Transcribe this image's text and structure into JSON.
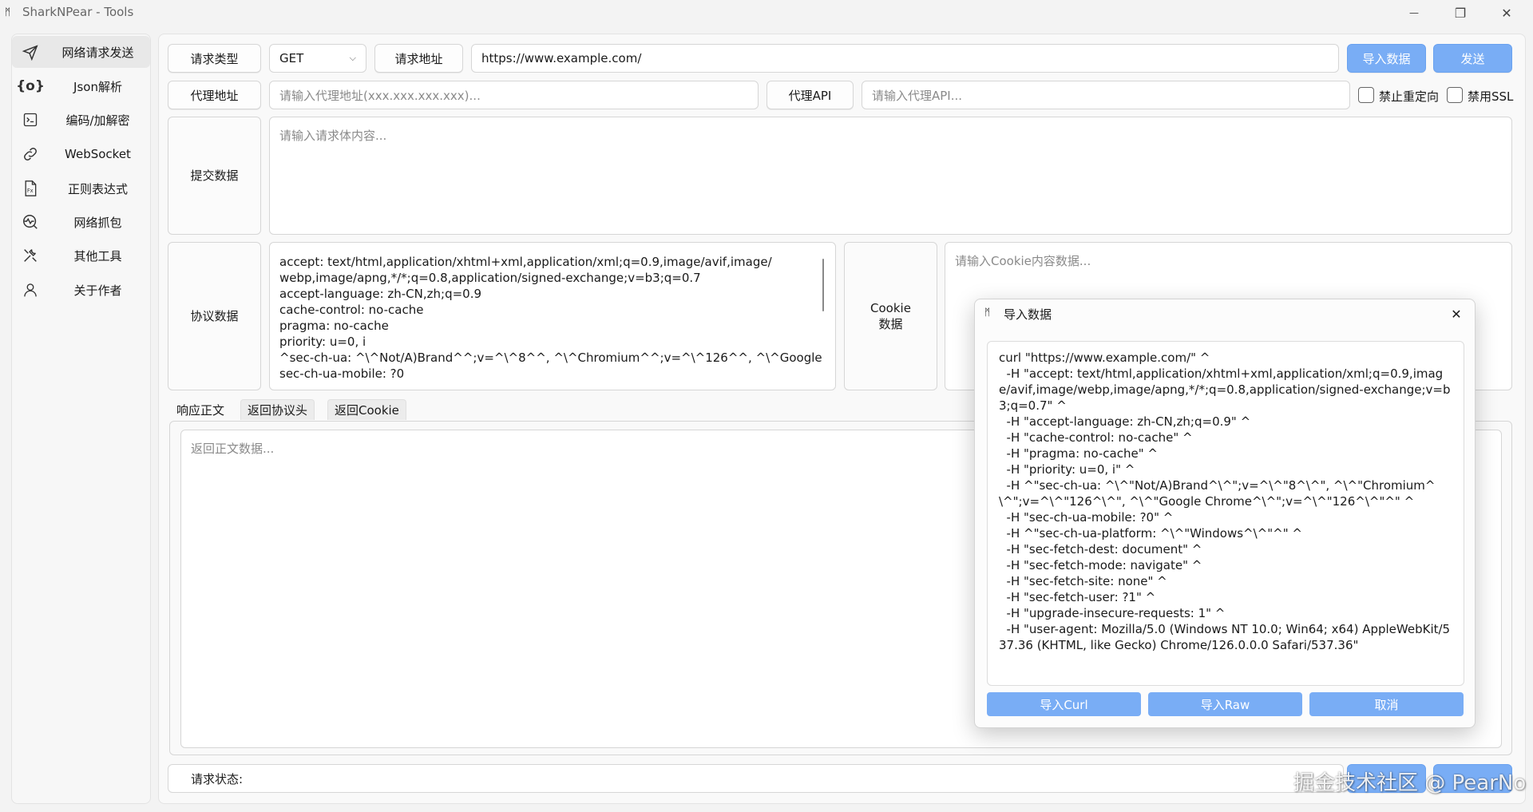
{
  "window": {
    "title": "SharkNPear - Tools",
    "logo_glyph": "ᛗ",
    "minimize_glyph": "—",
    "maximize_glyph": "❐",
    "close_glyph": "✕"
  },
  "sidebar": {
    "items": [
      {
        "label": "网络请求发送",
        "icon": "send-icon",
        "active": true
      },
      {
        "label": "Json解析",
        "icon": "json-braces-icon"
      },
      {
        "label": "编码/加解密",
        "icon": "terminal-icon"
      },
      {
        "label": "WebSocket",
        "icon": "link-icon"
      },
      {
        "label": "正则表达式",
        "icon": "regex-file-icon"
      },
      {
        "label": "网络抓包",
        "icon": "network-capture-icon"
      },
      {
        "label": "其他工具",
        "icon": "tools-icon"
      },
      {
        "label": "关于作者",
        "icon": "person-icon"
      }
    ]
  },
  "request": {
    "type_label": "请求类型",
    "method_value": "GET",
    "url_label": "请求地址",
    "url_value": "https://www.example.com/",
    "import_button": "导入数据",
    "send_button": "发送",
    "proxy_label": "代理地址",
    "proxy_placeholder": "请输入代理地址(xxx.xxx.xxx.xxx)...",
    "proxy_api_label": "代理API",
    "proxy_api_placeholder": "请输入代理API...",
    "no_redirect_label": "禁止重定向",
    "disable_ssl_label": "禁用SSL",
    "body_label": "提交数据",
    "body_placeholder": "请输入请求体内容...",
    "headers_label": "协议数据",
    "headers_lines": [
      "accept: text/html,application/xhtml+xml,application/xml;q=0.9,image/avif,image/",
      "webp,image/apng,*/*;q=0.8,application/signed-exchange;v=b3;q=0.7",
      "accept-language: zh-CN,zh;q=0.9",
      "cache-control: no-cache",
      "pragma: no-cache",
      "priority: u=0, i",
      "^sec-ch-ua: ^\\^Not/A)Brand^^;v=^\\^8^^, ^\\^Chromium^^;v=^\\^126^^, ^\\^Google",
      "sec-ch-ua-mobile: ?0"
    ],
    "cookie_label_line1": "Cookie",
    "cookie_label_line2": "数据",
    "cookie_placeholder": "请输入Cookie内容数据..."
  },
  "response": {
    "tabs": [
      "响应正文",
      "返回协议头",
      "返回Cookie"
    ],
    "active_tab": 0,
    "body_placeholder": "返回正文数据...",
    "status_label": "请求状态:"
  },
  "dialog": {
    "title": "导入数据",
    "close_glyph": "✕",
    "content": "curl \"https://www.example.com/\" ^\n  -H \"accept: text/html,application/xhtml+xml,application/xml;q=0.9,image/avif,image/webp,image/apng,*/*;q=0.8,application/signed-exchange;v=b3;q=0.7\" ^\n  -H \"accept-language: zh-CN,zh;q=0.9\" ^\n  -H \"cache-control: no-cache\" ^\n  -H \"pragma: no-cache\" ^\n  -H \"priority: u=0, i\" ^\n  -H ^\"sec-ch-ua: ^\\^\"Not/A)Brand^\\^\";v=^\\^\"8^\\^\", ^\\^\"Chromium^\\^\";v=^\\^\"126^\\^\", ^\\^\"Google Chrome^\\^\";v=^\\^\"126^\\^\"^\" ^\n  -H \"sec-ch-ua-mobile: ?0\" ^\n  -H ^\"sec-ch-ua-platform: ^\\^\"Windows^\\^\"^\" ^\n  -H \"sec-fetch-dest: document\" ^\n  -H \"sec-fetch-mode: navigate\" ^\n  -H \"sec-fetch-site: none\" ^\n  -H \"sec-fetch-user: ?1\" ^\n  -H \"upgrade-insecure-requests: 1\" ^\n  -H \"user-agent: Mozilla/5.0 (Windows NT 10.0; Win64; x64) AppleWebKit/537.36 (KHTML, like Gecko) Chrome/126.0.0.0 Safari/537.36\"",
    "buttons": {
      "import_curl": "导入Curl",
      "import_raw": "导入Raw",
      "cancel": "取消"
    }
  },
  "watermark": "掘金技术社区 @ PearNo",
  "colors": {
    "accent": "#79adf5",
    "background": "#f3f3f3",
    "panel": "#f9f9f9"
  }
}
